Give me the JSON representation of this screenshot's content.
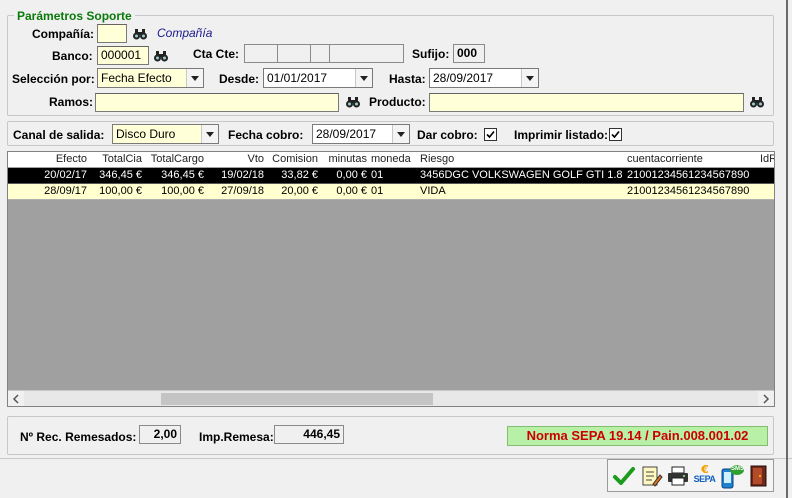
{
  "params": {
    "legend": "Parámetros Soporte",
    "compania_label": "Compañía:",
    "compania_value": "",
    "compania_name": "Compañía",
    "banco_label": "Banco:",
    "banco_value": "000001",
    "ctacte_label": "Cta Cte:",
    "sufijo_label": "Sufijo:",
    "sufijo_value": "000",
    "seleccion_label": "Selección por:",
    "seleccion_value": "Fecha Efecto",
    "desde_label": "Desde:",
    "desde_value": "01/01/2017",
    "hasta_label": "Hasta:",
    "hasta_value": "28/09/2017",
    "ramos_label": "Ramos:",
    "ramos_value": "",
    "producto_label": "Producto:",
    "producto_value": ""
  },
  "salida": {
    "canal_label": "Canal de salida:",
    "canal_value": "Disco Duro",
    "fecha_cobro_label": "Fecha cobro:",
    "fecha_cobro_value": "28/09/2017",
    "dar_cobro_label": "Dar cobro:",
    "dar_cobro_checked": true,
    "imprimir_label": "Imprimir listado:",
    "imprimir_checked": true
  },
  "grid": {
    "columns": [
      "Efecto",
      "TotalCia",
      "TotalCargo",
      "Vto",
      "Comision",
      "minutas",
      "moneda",
      "Riesgo",
      "cuentacorriente",
      "IdRe"
    ],
    "rows": [
      {
        "selected": true,
        "cells": [
          "20/02/17",
          "346,45 €",
          "346,45 €",
          "19/02/18",
          "33,82 €",
          "0,00 €",
          "01",
          "3456DGC VOLKSWAGEN GOLF GTI 1.8",
          "21001234561234567890",
          ""
        ]
      },
      {
        "selected": false,
        "cells": [
          "28/09/17",
          "100,00 €",
          "100,00 €",
          "27/09/18",
          "20,00 €",
          "0,00 €",
          "01",
          "VIDA",
          "21001234561234567890",
          ""
        ]
      }
    ]
  },
  "totals": {
    "nrec_label": "Nº Rec. Remesados:",
    "nrec_value": "2,00",
    "imp_label": "Imp.Remesa:",
    "imp_value": "446,45",
    "norma": "Norma SEPA 19.14 / Pain.008.001.02"
  },
  "toolbar": {
    "sepa_label": "SEPA",
    "sms_label": "SMS"
  },
  "colors": {
    "legend": "#0a7a0a",
    "norma_text": "#cc0000",
    "norma_bg": "#b8f0a8",
    "yellow_field": "#ffffd8",
    "link": "#1a1a8c"
  }
}
